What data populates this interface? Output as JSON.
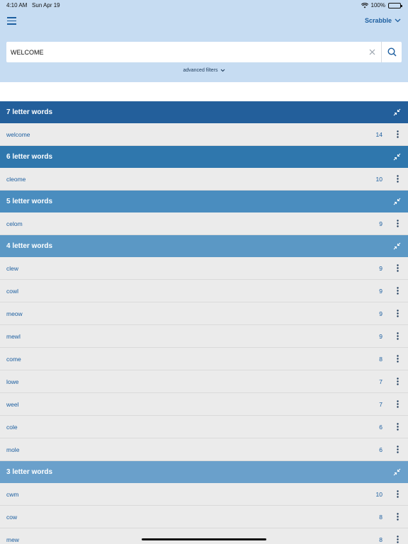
{
  "status": {
    "time": "4:10 AM",
    "date": "Sun Apr 19",
    "battery": "100%"
  },
  "header": {
    "dictionary": "Scrabble"
  },
  "search": {
    "value": "WELCOME",
    "placeholder": ""
  },
  "advanced": {
    "label": "advanced filters"
  },
  "colors": {
    "topbar": "#c6dcf2",
    "accent": "#1d5fa0"
  },
  "groups": [
    {
      "title": "7 letter words",
      "color": "#235f9b",
      "rows": [
        {
          "word": "welcome",
          "score": "14"
        }
      ]
    },
    {
      "title": "6 letter words",
      "color": "#2f77ad",
      "rows": [
        {
          "word": "cleome",
          "score": "10"
        }
      ]
    },
    {
      "title": "5 letter words",
      "color": "#4a8dbf",
      "rows": [
        {
          "word": "celom",
          "score": "9"
        }
      ]
    },
    {
      "title": "4 letter words",
      "color": "#5b98c5",
      "rows": [
        {
          "word": "clew",
          "score": "9"
        },
        {
          "word": "cowl",
          "score": "9"
        },
        {
          "word": "meow",
          "score": "9"
        },
        {
          "word": "mewl",
          "score": "9"
        },
        {
          "word": "come",
          "score": "8"
        },
        {
          "word": "lowe",
          "score": "7"
        },
        {
          "word": "weel",
          "score": "7"
        },
        {
          "word": "cole",
          "score": "6"
        },
        {
          "word": "mole",
          "score": "6"
        }
      ]
    },
    {
      "title": "3 letter words",
      "color": "#6aa0cb",
      "rows": [
        {
          "word": "cwm",
          "score": "10"
        },
        {
          "word": "cow",
          "score": "8"
        },
        {
          "word": "mew",
          "score": "8"
        }
      ]
    }
  ]
}
